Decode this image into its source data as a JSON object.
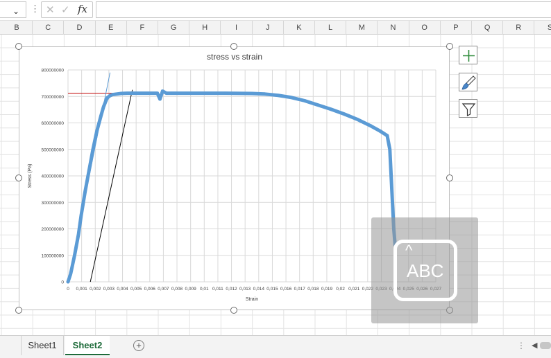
{
  "formula_bar": {
    "namebox_value": "",
    "more_icon": "⋮",
    "cancel_icon": "✕",
    "enter_icon": "✓",
    "fx_label": "fx",
    "formula_value": ""
  },
  "columns": [
    "B",
    "C",
    "D",
    "E",
    "F",
    "G",
    "H",
    "I",
    "J",
    "K",
    "L",
    "M",
    "N",
    "O",
    "P",
    "Q",
    "R",
    "S"
  ],
  "chart_data": {
    "type": "scatter",
    "title": "stress vs strain",
    "xlabel": "Strain",
    "ylabel": "Stress (Pa)",
    "xlim": [
      0,
      0.028
    ],
    "ylim": [
      0,
      800000000
    ],
    "yticks": [
      "800000000",
      "700000000",
      "600000000",
      "500000000",
      "400000000",
      "300000000",
      "200000000",
      "100000000",
      "0"
    ],
    "xticks": [
      "0",
      "0,001",
      "0,002",
      "0,003",
      "0,004",
      "0,005",
      "0,006",
      "0,007",
      "0,008",
      "0,009",
      "0,01",
      "0,011",
      "0,012",
      "0,013",
      "0,014",
      "0,015",
      "0,016",
      "0,017",
      "0,018",
      "0,019",
      "0,02",
      "0,021",
      "0,022",
      "0,023",
      "0,024",
      "0,025",
      "0,026",
      "0,027"
    ],
    "grid": true,
    "series": [
      {
        "color": "#5b9bd5",
        "x": [
          0,
          0.0002,
          0.0005,
          0.0008,
          0.001,
          0.0013,
          0.0016,
          0.0019,
          0.0022,
          0.0025,
          0.0027,
          0.0029,
          0.003,
          0.0032,
          0.0034,
          0.0037,
          0.004,
          0.0045,
          0.005,
          0.006,
          0.0068,
          0.007,
          0.0072,
          0.0075,
          0.008,
          0.009,
          0.01,
          0.012,
          0.014,
          0.015,
          0.016,
          0.017,
          0.018,
          0.019,
          0.02,
          0.021,
          0.022,
          0.023,
          0.0238,
          0.0243,
          0.0245,
          0.0246,
          0.0247,
          0.0248,
          0.0249
        ],
        "y": [
          0,
          30000000,
          100000000,
          180000000,
          250000000,
          340000000,
          420000000,
          500000000,
          570000000,
          625000000,
          660000000,
          685000000,
          695000000,
          703000000,
          707000000,
          709000000,
          711000000,
          712000000,
          712000000,
          712000000,
          712000000,
          690000000,
          720000000,
          712000000,
          712000000,
          712000000,
          712000000,
          712000000,
          711000000,
          709000000,
          704000000,
          696000000,
          684000000,
          668000000,
          652000000,
          634000000,
          614000000,
          590000000,
          568000000,
          552000000,
          500000000,
          400000000,
          300000000,
          200000000,
          140000000
        ]
      }
    ],
    "guides": [
      {
        "color": "#c00000",
        "x": [
          0,
          0.0052
        ],
        "y": [
          712000000,
          712000000
        ]
      },
      {
        "color": "#5b9bd5",
        "x": [
          0,
          0.0032
        ],
        "y": [
          0,
          790000000
        ]
      },
      {
        "color": "#000000",
        "x": [
          0.0017,
          0.0049
        ],
        "y": [
          0,
          725000000
        ]
      }
    ]
  },
  "side_buttons": {
    "elements_icon": "plus-icon",
    "styles_icon": "brush-icon",
    "filter_icon": "filter-icon"
  },
  "overlay": {
    "caret": "^",
    "text": "ABC"
  },
  "sheet_tabs": [
    "Sheet1",
    "Sheet2"
  ],
  "active_sheet": "Sheet2",
  "add_sheet_icon": "+",
  "scroll_dots": "⋮",
  "scroll_left_icon": "◀"
}
